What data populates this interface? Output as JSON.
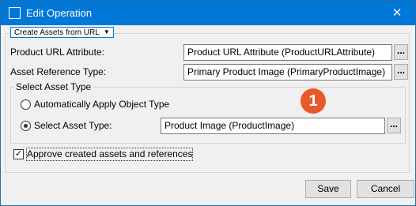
{
  "window": {
    "title": "Edit Operation",
    "close_glyph": "✕"
  },
  "group": {
    "legend": "Create Assets from URL",
    "legend_arrow": "▼"
  },
  "product_url": {
    "label": "Product URL Attribute:",
    "value": "Product URL Attribute (ProductURLAttribute)",
    "browse": "..."
  },
  "asset_ref": {
    "label": "Asset Reference Type:",
    "value": "Primary Product Image (PrimaryProductImage)",
    "browse": "..."
  },
  "select_asset_type": {
    "heading": "Select Asset Type",
    "auto_option": "Automatically Apply Object Type",
    "auto_selected": false,
    "select_option": "Select Asset Type:",
    "select_selected": true,
    "value": "Product Image (ProductImage)",
    "browse": "..."
  },
  "badge": "1",
  "approve": {
    "label": "Approve created assets and references",
    "checked": true,
    "check_glyph": "✓"
  },
  "buttons": {
    "save": "Save",
    "cancel": "Cancel"
  },
  "colors": {
    "titlebar": "#0078d7",
    "badge": "#e8582a"
  },
  "icons": {
    "title": "window-icon",
    "close": "close-icon",
    "dropdown": "chevron-down-icon"
  }
}
